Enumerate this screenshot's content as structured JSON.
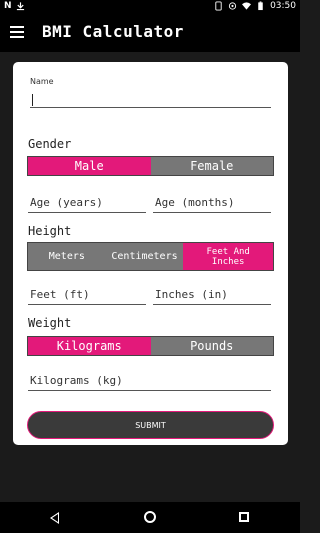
{
  "status_bar": {
    "time": "03:50",
    "left_icons": [
      "n-icon",
      "download-icon"
    ],
    "right_icons": [
      "phone-icon",
      "hotspot-icon",
      "wifi-icon",
      "battery-icon"
    ]
  },
  "app_bar": {
    "title": "BMI Calculator",
    "menu_icon": "menu-icon"
  },
  "form": {
    "name_label": "Name",
    "name_value": "",
    "gender_label": "Gender",
    "gender_options": [
      "Male",
      "Female"
    ],
    "gender_selected": "Male",
    "age_years_placeholder": "Age (years)",
    "age_months_placeholder": "Age (months)",
    "height_label": "Height",
    "height_options": [
      "Meters",
      "Centimeters",
      "Feet And Inches"
    ],
    "height_selected": "Feet And Inches",
    "feet_placeholder": "Feet (ft)",
    "inches_placeholder": "Inches (in)",
    "weight_label": "Weight",
    "weight_options": [
      "Kilograms",
      "Pounds"
    ],
    "weight_selected": "Kilograms",
    "kilograms_placeholder": "Kilograms (kg)",
    "submit_label": "SUBMIT"
  },
  "colors": {
    "accent": "#e3197a",
    "inactive": "#777777",
    "appbar": "#000000"
  }
}
